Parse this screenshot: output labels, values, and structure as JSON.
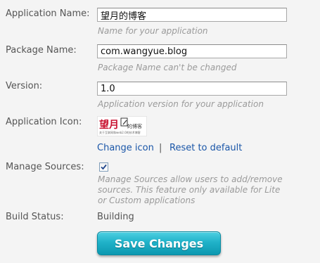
{
  "form": {
    "app_name": {
      "label": "Application Name:",
      "value": "望月的博客",
      "hint": "Name for your application"
    },
    "package_name": {
      "label": "Package Name:",
      "value": "com.wangyue.blog",
      "hint": "Package Name can't be changed"
    },
    "version": {
      "label": "Version:",
      "value": "1.0",
      "hint": "Application version for your application"
    },
    "app_icon": {
      "label": "Application Icon:",
      "icon_title": "望月",
      "icon_sub": "的博客",
      "icon_tagline": "关于互联网和web2.0的技术博客",
      "change_link": "Change icon",
      "separator": "|",
      "reset_link": "Reset to default"
    },
    "manage_sources": {
      "label": "Manage Sources:",
      "checked": true,
      "hint_lines": [
        "Manage Sources allow users to add/remove",
        "sources. This feature only available for Lite",
        "or Custom applications"
      ]
    },
    "build_status": {
      "label": "Build Status:",
      "value": "Building"
    },
    "save_button": "Save Changes"
  },
  "colors": {
    "link": "#1a56a8",
    "button": "#20b2c9",
    "icon_red": "#c8102e"
  }
}
